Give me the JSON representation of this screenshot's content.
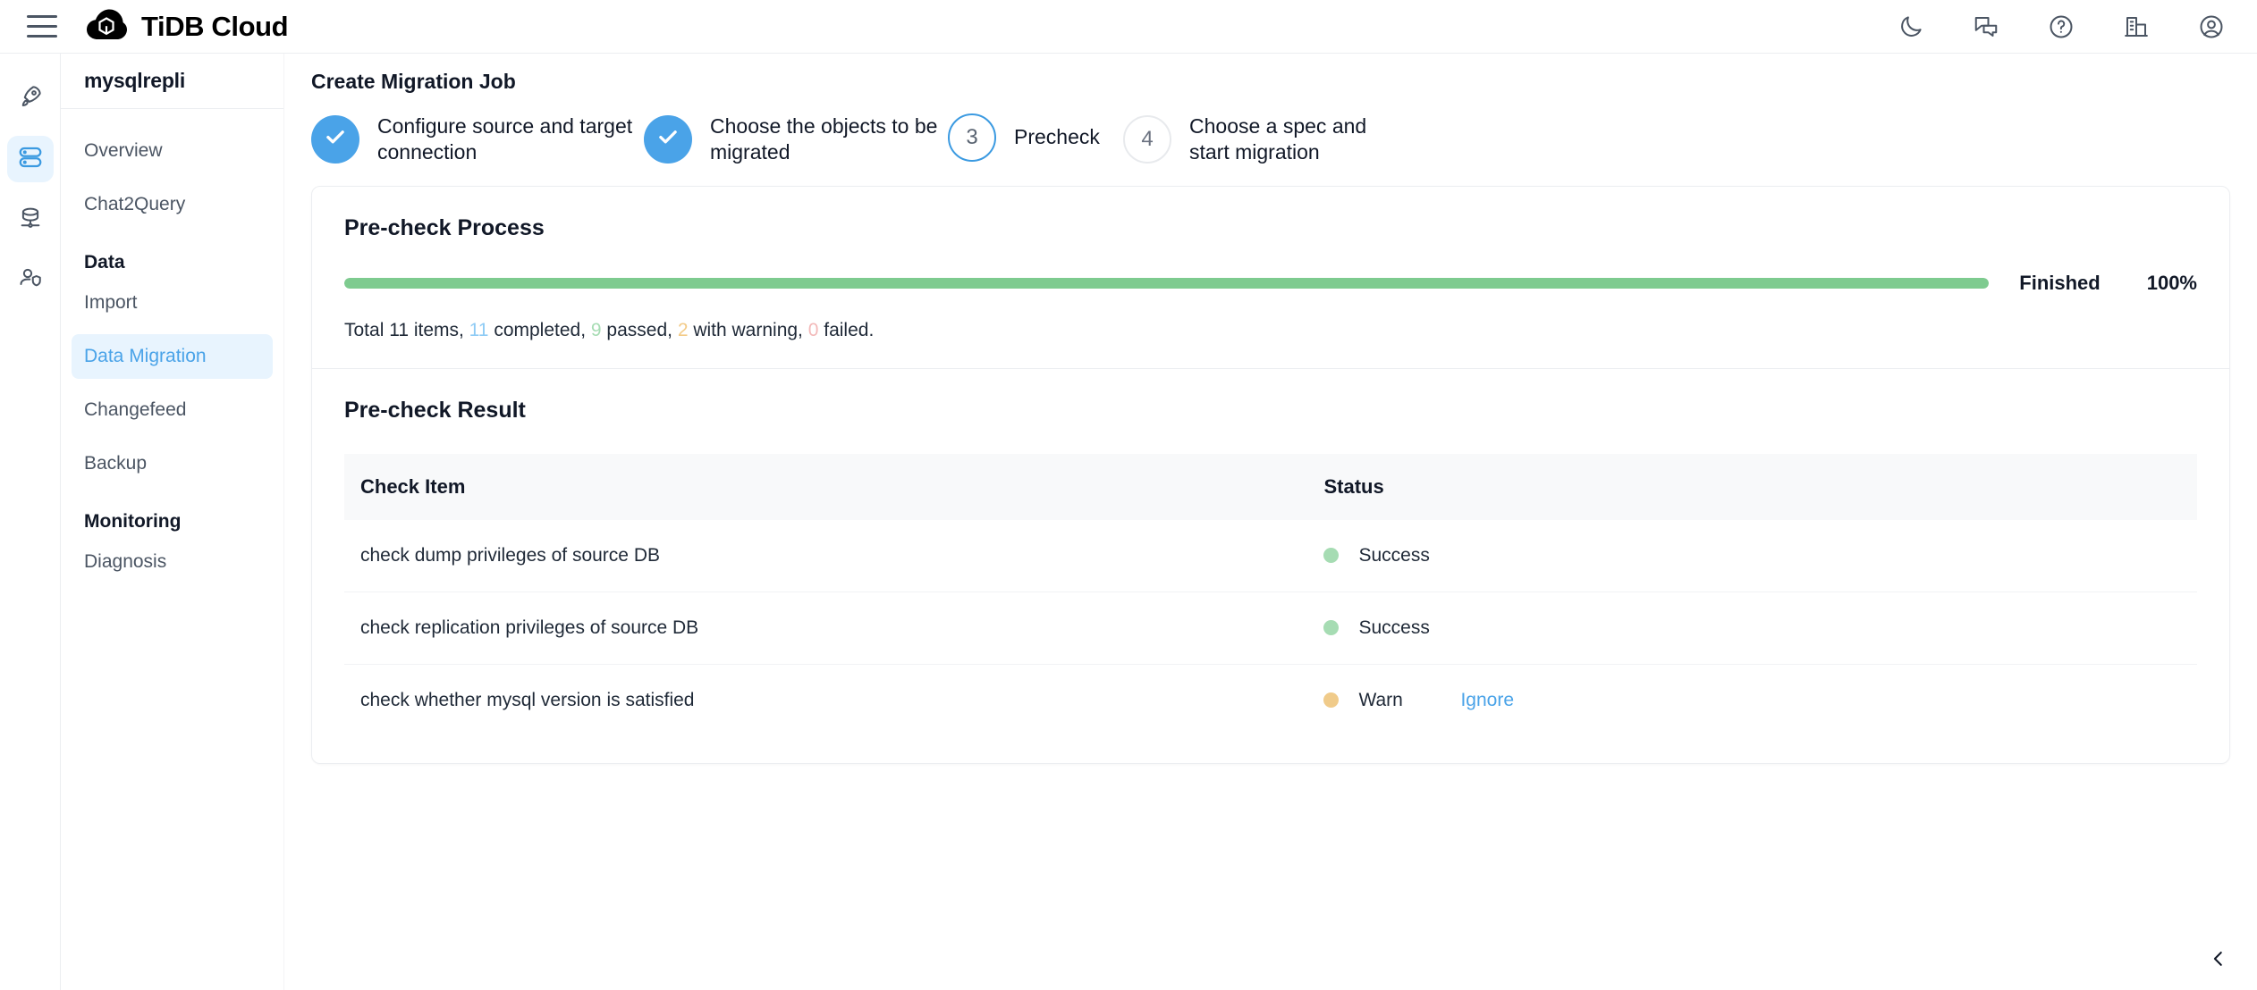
{
  "topbar": {
    "menu_icon": "hamburger-icon",
    "logo_icon": "tidb-cloud-logo",
    "brand": "TiDB Cloud",
    "icons": [
      {
        "name": "dark-mode-icon",
        "label": "Dark mode"
      },
      {
        "name": "feedback-chat-icon",
        "label": "Feedback"
      },
      {
        "name": "help-icon",
        "label": "Help"
      },
      {
        "name": "organization-icon",
        "label": "Organization"
      },
      {
        "name": "account-icon",
        "label": "Account"
      }
    ]
  },
  "rail": {
    "items": [
      {
        "name": "rail-item-getting-started",
        "icon": "rocket-icon",
        "active": false
      },
      {
        "name": "rail-item-clusters",
        "icon": "clusters-icon",
        "active": true
      },
      {
        "name": "rail-item-databases",
        "icon": "database-icon",
        "active": false
      },
      {
        "name": "rail-item-access",
        "icon": "user-shield-icon",
        "active": false
      }
    ]
  },
  "sidebar": {
    "cluster_name": "mysqlrepli",
    "items": [
      {
        "label": "Overview",
        "type": "link",
        "active": false
      },
      {
        "label": "Chat2Query",
        "type": "link",
        "active": false
      },
      {
        "label": "Data",
        "type": "group"
      },
      {
        "label": "Import",
        "type": "link",
        "active": false
      },
      {
        "label": "Data Migration",
        "type": "link",
        "active": true
      },
      {
        "label": "Changefeed",
        "type": "link",
        "active": false
      },
      {
        "label": "Backup",
        "type": "link",
        "active": false
      },
      {
        "label": "Monitoring",
        "type": "group"
      },
      {
        "label": "Diagnosis",
        "type": "link",
        "active": false
      }
    ]
  },
  "main": {
    "page_title": "Create Migration Job",
    "steps": [
      {
        "number": "1",
        "label": "Configure source and target connection",
        "state": "done",
        "check_icon": "check-icon"
      },
      {
        "number": "2",
        "label": "Choose the objects to be migrated",
        "state": "done",
        "check_icon": "check-icon"
      },
      {
        "number": "3",
        "label": "Precheck",
        "state": "current"
      },
      {
        "number": "4",
        "label": "Choose a spec and start migration",
        "state": "todo"
      }
    ],
    "process": {
      "title": "Pre-check Process",
      "status": "Finished",
      "percent_label": "100%",
      "percent_value": 100,
      "bar_color": "#7ecb8f",
      "summary": {
        "prefix": "Total 11 items, ",
        "total": "11",
        "completed": "11",
        "completed_suffix": " completed, ",
        "passed": "9",
        "passed_suffix": " passed, ",
        "warning": "2",
        "warning_suffix": " with warning, ",
        "failed": "0",
        "failed_suffix": " failed."
      }
    },
    "result": {
      "title": "Pre-check Result",
      "columns": [
        "Check Item",
        "Status"
      ],
      "rows": [
        {
          "item": "check dump privileges of source DB",
          "status": "Success",
          "status_type": "success",
          "action": ""
        },
        {
          "item": "check replication privileges of source DB",
          "status": "Success",
          "status_type": "success",
          "action": ""
        },
        {
          "item": "check whether mysql version is satisfied",
          "status": "Warn",
          "status_type": "warn",
          "action": "Ignore"
        }
      ]
    },
    "collapse_handle_icon": "chevron-left-icon"
  }
}
